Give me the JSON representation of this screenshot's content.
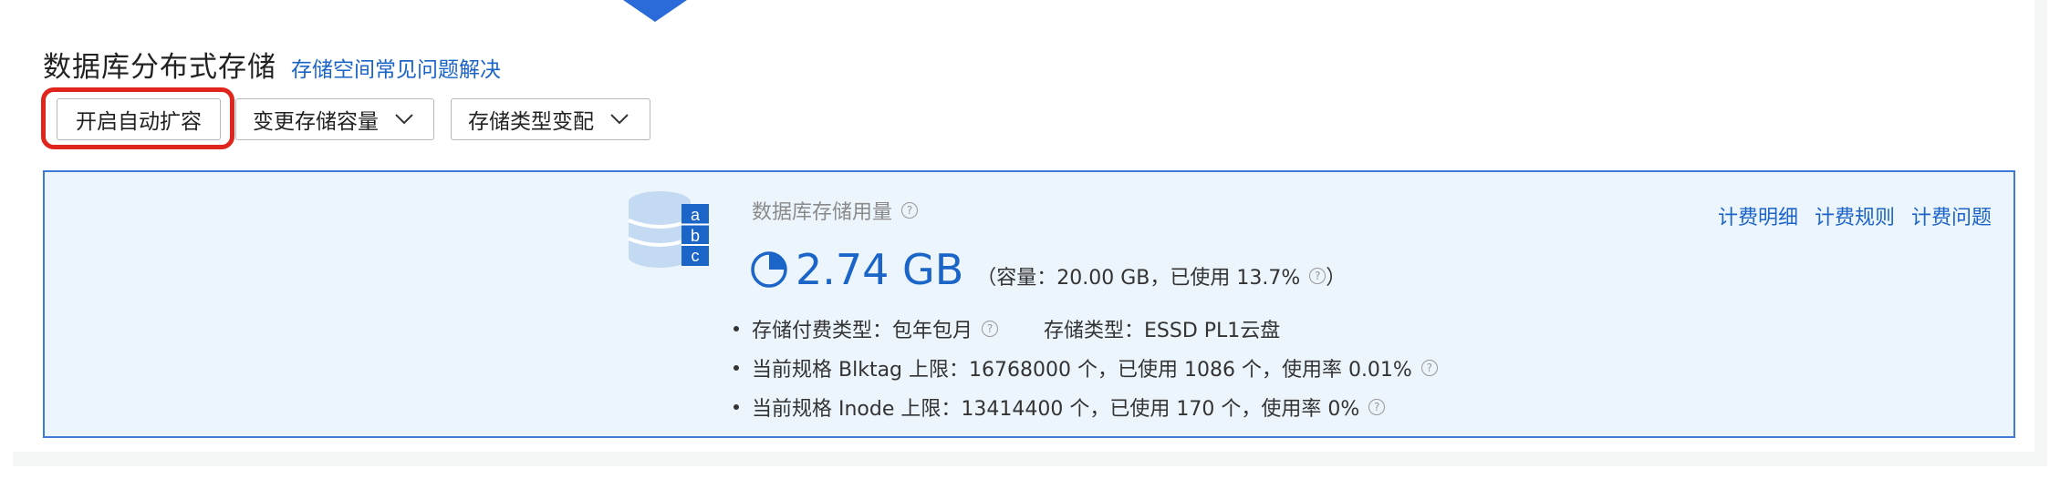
{
  "header": {
    "title": "数据库分布式存储",
    "help_link": "存储空间常见问题解决"
  },
  "toolbar": {
    "auto_expand_label": "开启自动扩容",
    "change_capacity_label": "变更存储容量",
    "change_type_label": "存储类型变配"
  },
  "storage": {
    "label": "数据库存储用量",
    "used": "2.74 GB",
    "detail": "（容量：20.00 GB，已使用 13.7%",
    "detail_close": "）",
    "items": [
      {
        "a": "存储付费类型：包年包月",
        "b": "存储类型：ESSD PL1云盘"
      },
      {
        "a": "当前规格 Blktag 上限：16768000 个，已使用 1086 个，使用率 0.01%"
      },
      {
        "a": "当前规格 Inode 上限：13414400 个，已使用 170 个，使用率 0%"
      }
    ],
    "links": [
      "计费明细",
      "计费规则",
      "计费问题"
    ],
    "icon_letters": [
      "a",
      "b",
      "c"
    ]
  },
  "colors": {
    "accent": "#1b64c8",
    "highlight": "#e0251d",
    "info_bg": "#ecf4fc",
    "info_border": "#3c7ad6"
  },
  "icons": [
    "chevron-down-icon",
    "database-icon",
    "pie-chart-icon",
    "question-icon"
  ]
}
